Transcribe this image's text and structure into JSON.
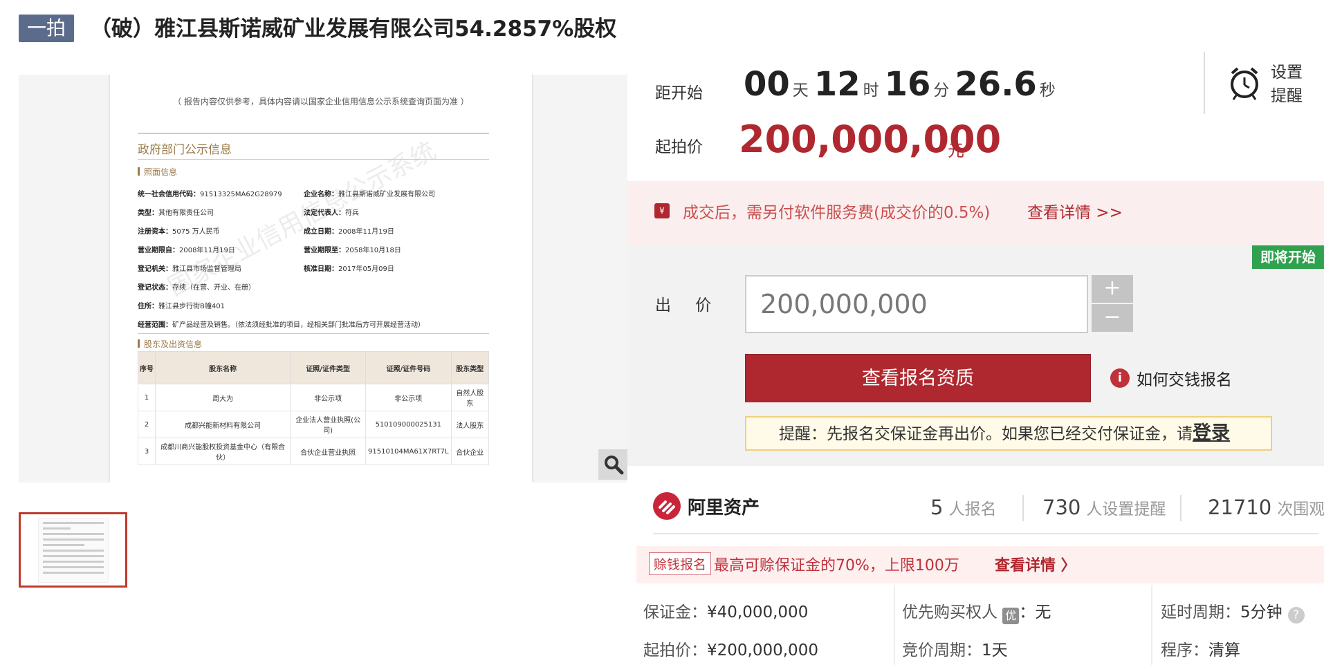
{
  "header": {
    "badge": "一拍",
    "title": "（破）雅江县斯诺威矿业发展有限公司54.2857%股权"
  },
  "document": {
    "note": "（ 报告内容仅供参考，具体内容请以国家企业信用信息公示系统查询页面为准 ）",
    "section_title": "政府部门公示信息",
    "watermark": "国家企业信用信息公示系统",
    "license_title": "照面信息",
    "fields_left": [
      {
        "label": "统一社会信用代码：",
        "value": "91513325MA62G28979"
      },
      {
        "label": "类型：",
        "value": "其他有限责任公司"
      },
      {
        "label": "注册资本：",
        "value": "5075 万人民币"
      },
      {
        "label": "营业期限自：",
        "value": "2008年11月19日"
      },
      {
        "label": "登记机关：",
        "value": "雅江县市场监督管理局"
      }
    ],
    "fields_right": [
      {
        "label": "企业名称：",
        "value": "雅江县斯诺威矿业发展有限公司"
      },
      {
        "label": "法定代表人：",
        "value": "符兵"
      },
      {
        "label": "成立日期：",
        "value": "2008年11月19日"
      },
      {
        "label": "营业期限至：",
        "value": "2058年10月18日"
      },
      {
        "label": "核准日期：",
        "value": "2017年05月09日"
      }
    ],
    "status_line": {
      "label": "登记状态：",
      "value": "存续（在营、开业、在册）"
    },
    "address_line": {
      "label": "住所：",
      "value": "雅江县步行街B幢401"
    },
    "scope_line": {
      "label": "经营范围：",
      "value": "矿产品经营及销售。（依法须经批准的项目，经相关部门批准后方可开展经营活动）"
    },
    "shareholders_title": "股东及出资信息",
    "table_headers": [
      "序号",
      "股东名称",
      "证照/证件类型",
      "证照/证件号码",
      "股东类型"
    ],
    "table_rows": [
      [
        "1",
        "周大为",
        "非公示项",
        "非公示项",
        "自然人股东"
      ],
      [
        "2",
        "成都兴能新材料有限公司",
        "企业法人营业执照(公司)",
        "510109000025131",
        "法人股东"
      ],
      [
        "3",
        "成都川商兴能股权投资基金中心（有限合伙）",
        "合伙企业营业执照",
        "91510104MA61X7RT7L",
        "合伙企业"
      ]
    ]
  },
  "countdown": {
    "label": "距开始",
    "days": "00",
    "days_unit": "天",
    "hours": "12",
    "hours_unit": "时",
    "minutes": "16",
    "minutes_unit": "分",
    "seconds": "26.6",
    "seconds_unit": "秒"
  },
  "remind": {
    "line1": "设置",
    "line2": "提醒",
    "icon": "alarm-clock-icon"
  },
  "start_price": {
    "label": "起拍价",
    "value": "200,000,000",
    "unit": "元"
  },
  "fee_notice": {
    "text": "成交后，需另付软件服务费(成交价的0.5%)",
    "link": "查看详情 >>",
    "icon_glyph": "¥"
  },
  "bid": {
    "status_tag": "即将开始",
    "label": "出 价",
    "input_value": "200,000,000",
    "plus": "+",
    "minus": "−",
    "primary_button": "查看报名资质",
    "howto": "如何交钱报名",
    "reminder_text": "提醒：先报名交保证金再出价。如果您已经交付保证金，请",
    "reminder_login": "登录"
  },
  "ali": {
    "name": "阿里资产",
    "stats": [
      {
        "num": "5",
        "label": "人报名"
      },
      {
        "num": "730",
        "label": "人设置提醒"
      },
      {
        "num": "21710",
        "label": "次围观"
      }
    ]
  },
  "promo": {
    "tag": "赊钱报名",
    "text": "最高可赊保证金的70%，上限100万",
    "link": "查看详情 〉"
  },
  "details": {
    "deposit_label": "保证金：",
    "deposit_value": "¥40,000,000",
    "start_label": "起拍价：",
    "start_value": "¥200,000,000",
    "priority_label": "优先购买权人",
    "priority_badge": "优",
    "priority_value": "：无",
    "cycle_label": "竞价周期：",
    "cycle_value": "1天",
    "delay_label": "延时周期：",
    "delay_value": "5分钟",
    "procedure_label": "程序：",
    "procedure_value": "清算"
  },
  "colors": {
    "brand_red": "#b0282f",
    "badge_blue": "#5b6b8c",
    "status_green": "#2fa14f"
  }
}
